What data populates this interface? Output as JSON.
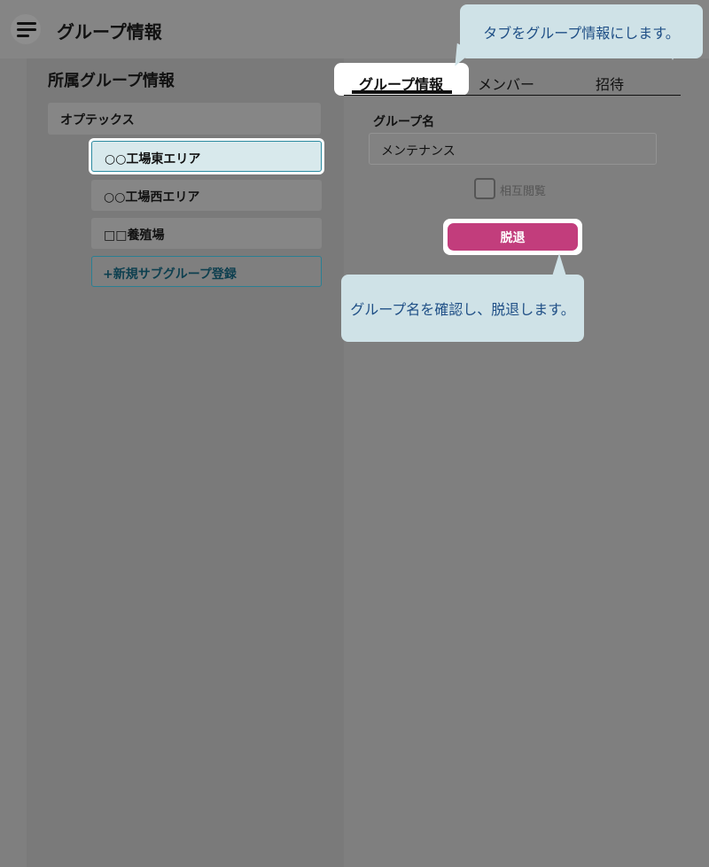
{
  "header": {
    "title": "グループ情報"
  },
  "left": {
    "title": "所属グループ情報",
    "org_name": "オプテックス",
    "subgroups": [
      {
        "label": "○○工場東エリア",
        "selected": true
      },
      {
        "label": "○○工場西エリア",
        "selected": false
      },
      {
        "label": "□□養殖場",
        "selected": false
      }
    ],
    "add_subgroup_label": "+新規サブグループ登録"
  },
  "tabs": [
    {
      "label": "グループ情報",
      "active": true
    },
    {
      "label": "メンバー",
      "active": false
    },
    {
      "label": "招待",
      "active": false
    }
  ],
  "form": {
    "group_name_label": "グループ名",
    "group_name_value": "メンテナンス",
    "checkbox_label": "相互閲覧",
    "checkbox_checked": false,
    "withdraw_label": "脱退"
  },
  "callouts": {
    "tab_hint": "タブをグループ情報にします。",
    "withdraw_hint": "グループ名を確認し、脱退します。"
  },
  "colors": {
    "withdraw_button": "#c23d7c",
    "callout_bg": "#cfe2e7",
    "callout_text": "#1f4f86",
    "selected_border": "#2a8aa0"
  }
}
